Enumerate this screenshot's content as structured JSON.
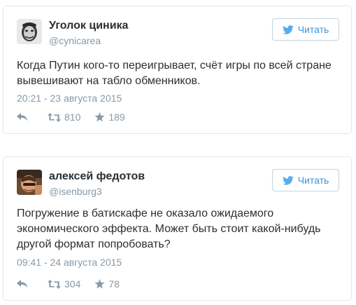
{
  "tweets": [
    {
      "name": "Уголок циника",
      "handle": "@cynicarea",
      "follow_label": "Читать",
      "text": "Когда Путин кого-то переигрывает, счёт игры по всей стране вывешивают на табло обменников.",
      "time": "20:21 - 23 августа 2015",
      "retweets": "810",
      "likes": "189",
      "avatar_icon": "photo-avatar-icon"
    },
    {
      "name": "алексей федотов",
      "handle": "@isenburg3",
      "follow_label": "Читать",
      "text": "Погружение в батискафе не оказало ожидаемого экономического эффекта. Может быть стоит какой-нибудь другой формат попробовать?",
      "time": "09:41 - 24 августа 2015",
      "retweets": "304",
      "likes": "78",
      "avatar_icon": "photo-avatar-icon"
    }
  ],
  "colors": {
    "accent": "#3b94d9",
    "muted": "#8899a6",
    "text": "#292f33",
    "border": "#e1e8ed"
  },
  "icons": [
    "bird-icon",
    "reply-icon",
    "retweet-icon",
    "star-icon"
  ]
}
